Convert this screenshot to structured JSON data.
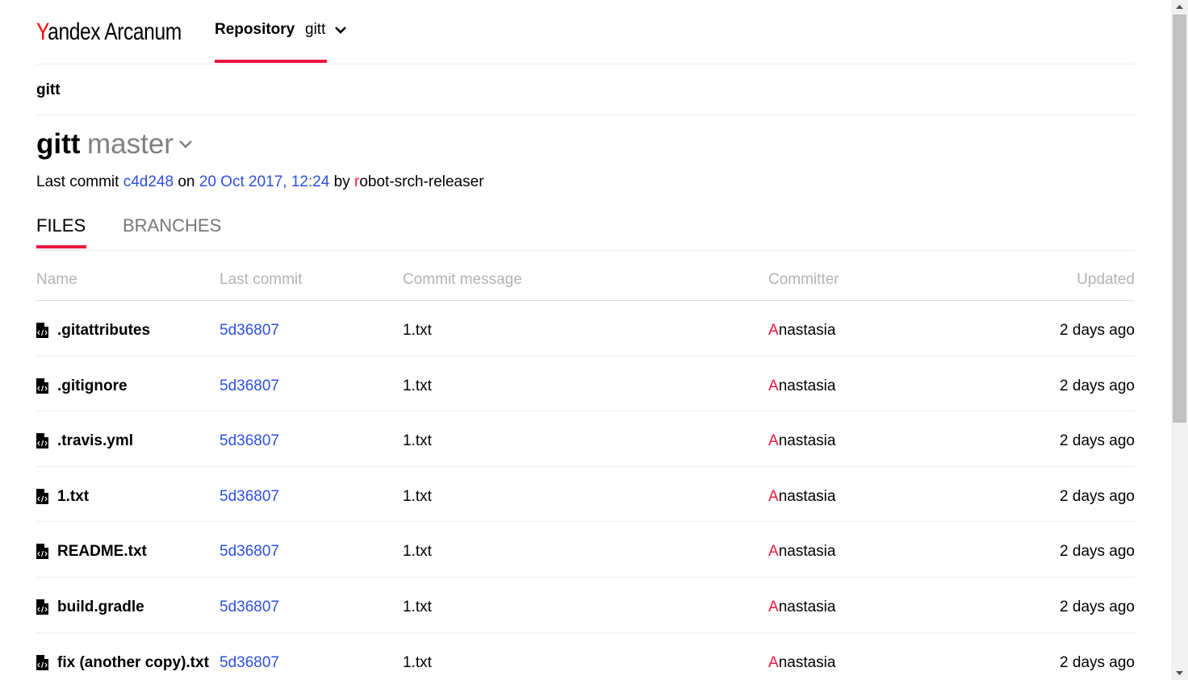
{
  "header": {
    "logo_brand": "Yandex",
    "logo_product": "Arcanum",
    "nav_label": "Repository",
    "nav_value": "gitt"
  },
  "breadcrumb": "gitt",
  "repo": {
    "name": "gitt",
    "branch": "master",
    "last_commit_prefix": "Last commit",
    "last_commit_hash": "c4d248",
    "on": "on",
    "last_commit_date": "20 Oct 2017, 12:24",
    "by": "by",
    "author_first": "r",
    "author_rest": "obot-srch-releaser"
  },
  "tabs": [
    {
      "label": "FILES",
      "active": true
    },
    {
      "label": "BRANCHES",
      "active": false
    }
  ],
  "table": {
    "headers": [
      "Name",
      "Last commit",
      "Commit message",
      "Committer",
      "Updated"
    ],
    "rows": [
      {
        "name": ".gitattributes",
        "commit": "5d36807",
        "message": "1.txt",
        "committer_first": "A",
        "committer_rest": "nastasia",
        "updated": "2 days ago"
      },
      {
        "name": ".gitignore",
        "commit": "5d36807",
        "message": "1.txt",
        "committer_first": "A",
        "committer_rest": "nastasia",
        "updated": "2 days ago"
      },
      {
        "name": ".travis.yml",
        "commit": "5d36807",
        "message": "1.txt",
        "committer_first": "A",
        "committer_rest": "nastasia",
        "updated": "2 days ago"
      },
      {
        "name": "1.txt",
        "commit": "5d36807",
        "message": "1.txt",
        "committer_first": "A",
        "committer_rest": "nastasia",
        "updated": "2 days ago"
      },
      {
        "name": "README.txt",
        "commit": "5d36807",
        "message": "1.txt",
        "committer_first": "A",
        "committer_rest": "nastasia",
        "updated": "2 days ago"
      },
      {
        "name": "build.gradle",
        "commit": "5d36807",
        "message": "1.txt",
        "committer_first": "A",
        "committer_rest": "nastasia",
        "updated": "2 days ago"
      },
      {
        "name": "fix (another copy).txt",
        "commit": "5d36807",
        "message": "1.txt",
        "committer_first": "A",
        "committer_rest": "nastasia",
        "updated": "2 days ago"
      }
    ]
  },
  "colors": {
    "accent": "#f0173f",
    "link": "#2e4fe0",
    "muted": "#b3b3b3"
  }
}
